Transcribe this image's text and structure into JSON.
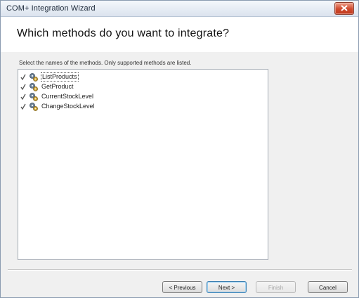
{
  "window": {
    "title": "COM+ Integration Wizard"
  },
  "header": {
    "title": "Which methods do you want to integrate?"
  },
  "instruction": "Select the names of the methods. Only supported methods are listed.",
  "methods": [
    {
      "label": "ListProducts",
      "checked": true,
      "selected": true
    },
    {
      "label": "GetProduct",
      "checked": true,
      "selected": false
    },
    {
      "label": "CurrentStockLevel",
      "checked": true,
      "selected": false
    },
    {
      "label": "ChangeStockLevel",
      "checked": true,
      "selected": false
    }
  ],
  "buttons": {
    "previous": "< Previous",
    "next": "Next >",
    "finish": "Finish",
    "cancel": "Cancel"
  },
  "icons": {
    "close": "close-icon",
    "method": "gear-icon",
    "check": "check-icon"
  },
  "colors": {
    "close_button": "#cf4a2e",
    "window_bg": "#f0f0f0",
    "header_bg": "#ffffff"
  }
}
